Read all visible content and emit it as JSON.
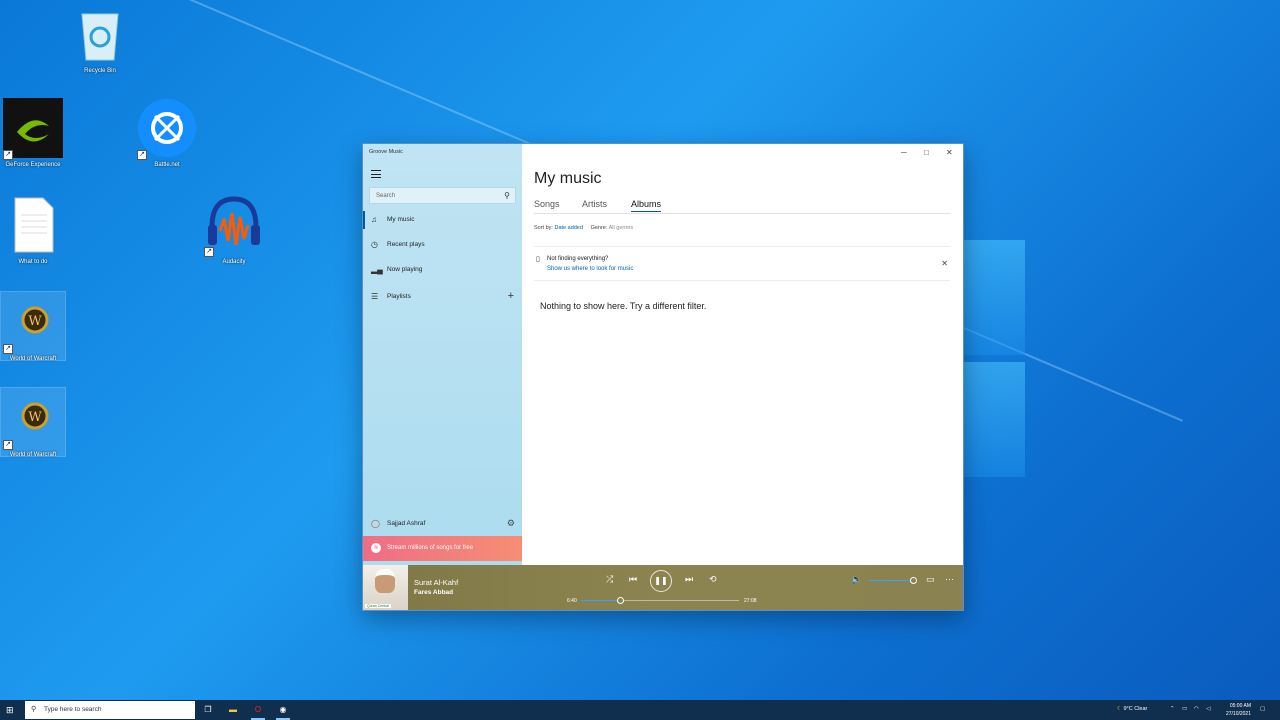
{
  "desktop": {
    "icons": [
      {
        "name": "recycle-bin",
        "label": "Recycle Bin"
      },
      {
        "name": "geforce-experience",
        "label": "GeForce Experience"
      },
      {
        "name": "battlenet",
        "label": "Battle.net"
      },
      {
        "name": "what-to-do",
        "label": "What to do"
      },
      {
        "name": "audacity",
        "label": "Audacity"
      },
      {
        "name": "world-of-warcraft-1",
        "label": "World of Warcraft"
      },
      {
        "name": "world-of-warcraft-2",
        "label": "World of Warcraft"
      }
    ]
  },
  "app": {
    "title": "Groove Music",
    "search_placeholder": "Search",
    "nav": [
      {
        "label": "My music",
        "icon": "music-note-icon"
      },
      {
        "label": "Recent plays",
        "icon": "clock-icon"
      },
      {
        "label": "Now playing",
        "icon": "bars-icon"
      },
      {
        "label": "Playlists",
        "icon": "list-icon"
      }
    ],
    "user": "Sajjad Ashraf",
    "promo": "Stream millions of songs for free"
  },
  "main": {
    "title": "My music",
    "tabs": [
      "Songs",
      "Artists",
      "Albums"
    ],
    "active_tab": "Albums",
    "sort_label": "Sort by:",
    "sort_value": "Date added",
    "genre_label": "Genre:",
    "genre_value": "All genres",
    "notice_title": "Not finding everything?",
    "notice_link": "Show us where to look for music",
    "empty_message": "Nothing to show here. Try a different filter."
  },
  "player": {
    "album_tag": "Quran Central",
    "track": "Surat Al-Kahf",
    "artist": "Fares Abbad",
    "elapsed": "6:40",
    "duration": "27:08",
    "progress_fraction": 0.25,
    "volume_fraction": 1.0
  },
  "taskbar": {
    "search_placeholder": "Type here to search",
    "weather": "9°C  Clear",
    "time": "05:00 AM",
    "date": "27/10/2021"
  },
  "colors": {
    "accent": "#005a9e",
    "sidebar": "#b6e0f2",
    "player_bg": "#8a8250",
    "promo": "#ef6d85"
  }
}
